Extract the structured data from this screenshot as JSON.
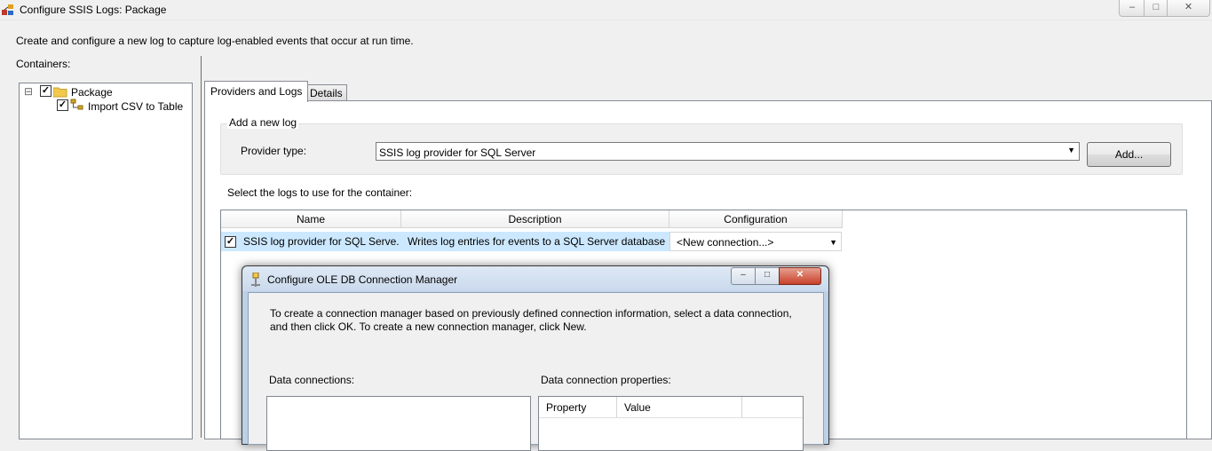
{
  "window": {
    "title": "Configure SSIS Logs: Package",
    "controls": {
      "minimize": "–",
      "maximize": "□",
      "close": "✕"
    }
  },
  "description": "Create and configure a new log to capture log-enabled events that occur at run time.",
  "containers": {
    "label": "Containers:",
    "tree": [
      {
        "label": "Package",
        "checked": true,
        "expanded": true,
        "expander": "⊟",
        "icon": "folder-icon"
      },
      {
        "label": "Import CSV to Table",
        "checked": true,
        "icon": "data-flow-icon"
      }
    ]
  },
  "tabs": [
    {
      "label": "Providers and Logs",
      "active": true
    },
    {
      "label": "Details",
      "active": false
    }
  ],
  "add_log": {
    "group_title": "Add a new log",
    "provider_label": "Provider type:",
    "provider_value": "SSIS log provider for SQL Server",
    "add_button": "Add..."
  },
  "logs": {
    "label": "Select the logs to use for the container:",
    "columns": [
      "Name",
      "Description",
      "Configuration"
    ],
    "rows": [
      {
        "checked": true,
        "name": "SSIS log provider for SQL Serve...",
        "description": "Writes log entries for events to a SQL Server database",
        "configuration": "<New connection...>"
      }
    ]
  },
  "dialog": {
    "title": "Configure OLE DB Connection Manager",
    "instruction_line1": "To create a connection manager based on previously defined connection information, select a data connection,",
    "instruction_line2": "and then click OK. To create a new connection manager, click New.",
    "data_connections_label": "Data connections:",
    "properties_label": "Data connection properties:",
    "properties_columns": [
      "Property",
      "Value"
    ]
  },
  "colors": {
    "selection": "#cce8ff",
    "window_bg": "#f0f0f0",
    "dialog_frame": "#bcd0e6"
  }
}
